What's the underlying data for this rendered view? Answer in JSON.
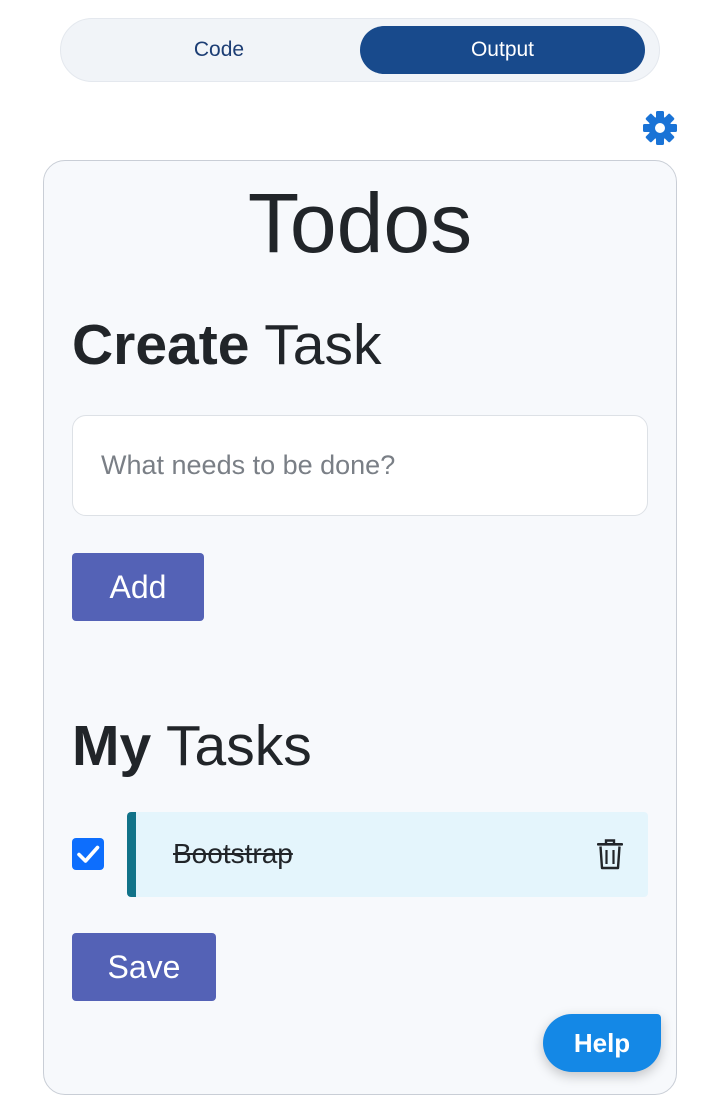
{
  "header": {
    "tabs": [
      "Code",
      "Output"
    ],
    "active_tab": "Output"
  },
  "app": {
    "title": "Todos",
    "create_section": {
      "heading_strong": "Create",
      "heading_rest": " Task",
      "input_placeholder": "What needs to be done?",
      "input_value": "",
      "add_label": "Add"
    },
    "tasks_section": {
      "heading_strong": "My",
      "heading_rest": " Tasks",
      "tasks": [
        {
          "text": "Bootstrap",
          "completed": true
        }
      ],
      "save_label": "Save"
    }
  },
  "help_label": "Help",
  "icons": {
    "settings": "gear-icon",
    "delete": "trash-icon",
    "checkbox": "checkmark-icon"
  },
  "colors": {
    "active_tab": "#184a8c",
    "primary_button": "#5462b6",
    "task_accent": "#117389",
    "task_background": "#e4f5fc",
    "checkbox": "#0d6efd",
    "help": "#1488e6",
    "gear": "#1a73d6"
  }
}
